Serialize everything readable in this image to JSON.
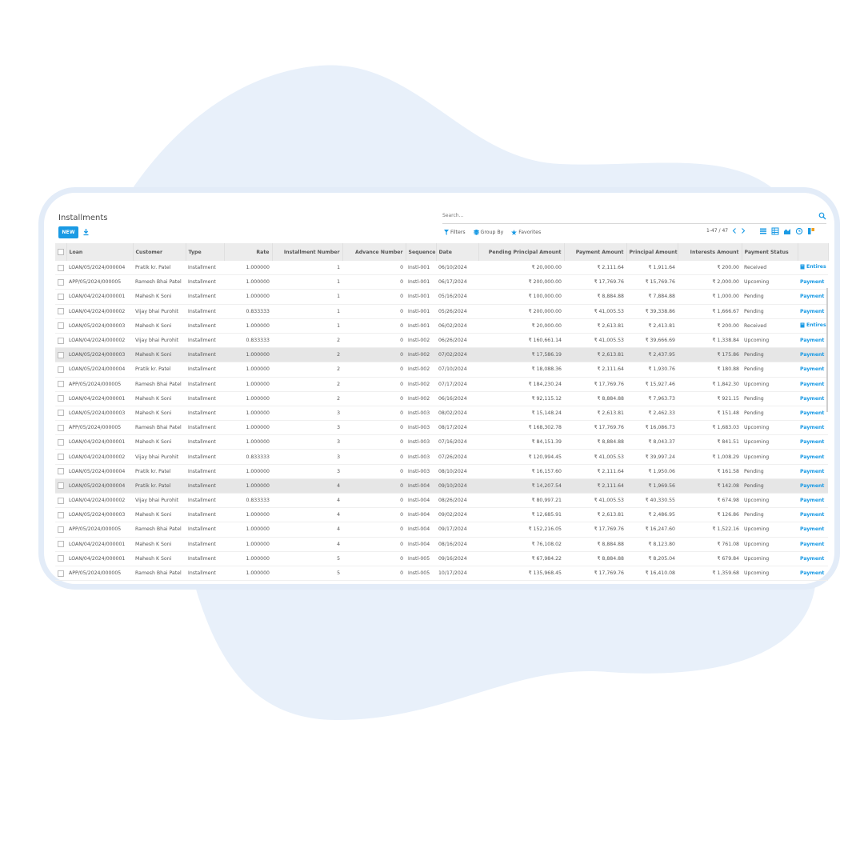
{
  "header": {
    "title": "Installments",
    "search_placeholder": "Search...",
    "new_label": "NEW",
    "filters_label": "Filters",
    "group_by_label": "Group By",
    "favorites_label": "Favorites",
    "pager": "1-47 / 47"
  },
  "colors": {
    "accent": "#1a9ae4",
    "header_bg": "#ececec",
    "blob": "#e8f0fa"
  },
  "table": {
    "columns": [
      "Loan",
      "Customer",
      "Type",
      "Rate",
      "Installment Number",
      "Advance Number",
      "Sequence",
      "Date",
      "Pending Principal Amount",
      "Payment Amount",
      "Principal Amount",
      "Interests Amount",
      "Payment Status"
    ],
    "rows": [
      {
        "loan": "LOAN/05/2024/000004",
        "customer": "Pratik kr. Patel",
        "type": "Installment",
        "rate": "1.000000",
        "inst": "1",
        "adv": "0",
        "seq": "Instl-001",
        "date": "06/10/2024",
        "pending": "₹ 20,000.00",
        "payment": "₹ 2,111.64",
        "principal": "₹ 1,911.64",
        "interest": "₹ 200.00",
        "status": "Received",
        "action": "Entires",
        "action_kind": "entries"
      },
      {
        "loan": "APP/05/2024/000005",
        "customer": "Ramesh Bhai Patel",
        "type": "Installment",
        "rate": "1.000000",
        "inst": "1",
        "adv": "0",
        "seq": "Instl-001",
        "date": "06/17/2024",
        "pending": "₹ 200,000.00",
        "payment": "₹ 17,769.76",
        "principal": "₹ 15,769.76",
        "interest": "₹ 2,000.00",
        "status": "Upcoming",
        "action": "Payment",
        "action_kind": "payment"
      },
      {
        "loan": "LOAN/04/2024/000001",
        "customer": "Mahesh K Soni",
        "type": "Installment",
        "rate": "1.000000",
        "inst": "1",
        "adv": "0",
        "seq": "Instl-001",
        "date": "05/16/2024",
        "pending": "₹ 100,000.00",
        "payment": "₹ 8,884.88",
        "principal": "₹ 7,884.88",
        "interest": "₹ 1,000.00",
        "status": "Pending",
        "action": "Payment",
        "action_kind": "payment"
      },
      {
        "loan": "LOAN/04/2024/000002",
        "customer": "Vijay bhai Purohit",
        "type": "Installment",
        "rate": "0.833333",
        "inst": "1",
        "adv": "0",
        "seq": "Instl-001",
        "date": "05/26/2024",
        "pending": "₹ 200,000.00",
        "payment": "₹ 41,005.53",
        "principal": "₹ 39,338.86",
        "interest": "₹ 1,666.67",
        "status": "Pending",
        "action": "Payment",
        "action_kind": "payment"
      },
      {
        "loan": "LOAN/05/2024/000003",
        "customer": "Mahesh K Soni",
        "type": "Installment",
        "rate": "1.000000",
        "inst": "1",
        "adv": "0",
        "seq": "Instl-001",
        "date": "06/02/2024",
        "pending": "₹ 20,000.00",
        "payment": "₹ 2,613.81",
        "principal": "₹ 2,413.81",
        "interest": "₹ 200.00",
        "status": "Received",
        "action": "Entires",
        "action_kind": "entries"
      },
      {
        "loan": "LOAN/04/2024/000002",
        "customer": "Vijay bhai Purohit",
        "type": "Installment",
        "rate": "0.833333",
        "inst": "2",
        "adv": "0",
        "seq": "Instl-002",
        "date": "06/26/2024",
        "pending": "₹ 160,661.14",
        "payment": "₹ 41,005.53",
        "principal": "₹ 39,666.69",
        "interest": "₹ 1,338.84",
        "status": "Upcoming",
        "action": "Payment",
        "action_kind": "payment"
      },
      {
        "loan": "LOAN/05/2024/000003",
        "customer": "Mahesh K Soni",
        "type": "Installment",
        "rate": "1.000000",
        "inst": "2",
        "adv": "0",
        "seq": "Instl-002",
        "date": "07/02/2024",
        "pending": "₹ 17,586.19",
        "payment": "₹ 2,613.81",
        "principal": "₹ 2,437.95",
        "interest": "₹ 175.86",
        "status": "Pending",
        "action": "Payment",
        "action_kind": "payment",
        "highlight": true
      },
      {
        "loan": "LOAN/05/2024/000004",
        "customer": "Pratik kr. Patel",
        "type": "Installment",
        "rate": "1.000000",
        "inst": "2",
        "adv": "0",
        "seq": "Instl-002",
        "date": "07/10/2024",
        "pending": "₹ 18,088.36",
        "payment": "₹ 2,111.64",
        "principal": "₹ 1,930.76",
        "interest": "₹ 180.88",
        "status": "Pending",
        "action": "Payment",
        "action_kind": "payment"
      },
      {
        "loan": "APP/05/2024/000005",
        "customer": "Ramesh Bhai Patel",
        "type": "Installment",
        "rate": "1.000000",
        "inst": "2",
        "adv": "0",
        "seq": "Instl-002",
        "date": "07/17/2024",
        "pending": "₹ 184,230.24",
        "payment": "₹ 17,769.76",
        "principal": "₹ 15,927.46",
        "interest": "₹ 1,842.30",
        "status": "Upcoming",
        "action": "Payment",
        "action_kind": "payment"
      },
      {
        "loan": "LOAN/04/2024/000001",
        "customer": "Mahesh K Soni",
        "type": "Installment",
        "rate": "1.000000",
        "inst": "2",
        "adv": "0",
        "seq": "Instl-002",
        "date": "06/16/2024",
        "pending": "₹ 92,115.12",
        "payment": "₹ 8,884.88",
        "principal": "₹ 7,963.73",
        "interest": "₹ 921.15",
        "status": "Pending",
        "action": "Payment",
        "action_kind": "payment"
      },
      {
        "loan": "LOAN/05/2024/000003",
        "customer": "Mahesh K Soni",
        "type": "Installment",
        "rate": "1.000000",
        "inst": "3",
        "adv": "0",
        "seq": "Instl-003",
        "date": "08/02/2024",
        "pending": "₹ 15,148.24",
        "payment": "₹ 2,613.81",
        "principal": "₹ 2,462.33",
        "interest": "₹ 151.48",
        "status": "Pending",
        "action": "Payment",
        "action_kind": "payment"
      },
      {
        "loan": "APP/05/2024/000005",
        "customer": "Ramesh Bhai Patel",
        "type": "Installment",
        "rate": "1.000000",
        "inst": "3",
        "adv": "0",
        "seq": "Instl-003",
        "date": "08/17/2024",
        "pending": "₹ 168,302.78",
        "payment": "₹ 17,769.76",
        "principal": "₹ 16,086.73",
        "interest": "₹ 1,683.03",
        "status": "Upcoming",
        "action": "Payment",
        "action_kind": "payment"
      },
      {
        "loan": "LOAN/04/2024/000001",
        "customer": "Mahesh K Soni",
        "type": "Installment",
        "rate": "1.000000",
        "inst": "3",
        "adv": "0",
        "seq": "Instl-003",
        "date": "07/16/2024",
        "pending": "₹ 84,151.39",
        "payment": "₹ 8,884.88",
        "principal": "₹ 8,043.37",
        "interest": "₹ 841.51",
        "status": "Upcoming",
        "action": "Payment",
        "action_kind": "payment"
      },
      {
        "loan": "LOAN/04/2024/000002",
        "customer": "Vijay bhai Purohit",
        "type": "Installment",
        "rate": "0.833333",
        "inst": "3",
        "adv": "0",
        "seq": "Instl-003",
        "date": "07/26/2024",
        "pending": "₹ 120,994.45",
        "payment": "₹ 41,005.53",
        "principal": "₹ 39,997.24",
        "interest": "₹ 1,008.29",
        "status": "Upcoming",
        "action": "Payment",
        "action_kind": "payment"
      },
      {
        "loan": "LOAN/05/2024/000004",
        "customer": "Pratik kr. Patel",
        "type": "Installment",
        "rate": "1.000000",
        "inst": "3",
        "adv": "0",
        "seq": "Instl-003",
        "date": "08/10/2024",
        "pending": "₹ 16,157.60",
        "payment": "₹ 2,111.64",
        "principal": "₹ 1,950.06",
        "interest": "₹ 161.58",
        "status": "Pending",
        "action": "Payment",
        "action_kind": "payment"
      },
      {
        "loan": "LOAN/05/2024/000004",
        "customer": "Pratik kr. Patel",
        "type": "Installment",
        "rate": "1.000000",
        "inst": "4",
        "adv": "0",
        "seq": "Instl-004",
        "date": "09/10/2024",
        "pending": "₹ 14,207.54",
        "payment": "₹ 2,111.64",
        "principal": "₹ 1,969.56",
        "interest": "₹ 142.08",
        "status": "Pending",
        "action": "Payment",
        "action_kind": "payment",
        "highlight": true
      },
      {
        "loan": "LOAN/04/2024/000002",
        "customer": "Vijay bhai Purohit",
        "type": "Installment",
        "rate": "0.833333",
        "inst": "4",
        "adv": "0",
        "seq": "Instl-004",
        "date": "08/26/2024",
        "pending": "₹ 80,997.21",
        "payment": "₹ 41,005.53",
        "principal": "₹ 40,330.55",
        "interest": "₹ 674.98",
        "status": "Upcoming",
        "action": "Payment",
        "action_kind": "payment"
      },
      {
        "loan": "LOAN/05/2024/000003",
        "customer": "Mahesh K Soni",
        "type": "Installment",
        "rate": "1.000000",
        "inst": "4",
        "adv": "0",
        "seq": "Instl-004",
        "date": "09/02/2024",
        "pending": "₹ 12,685.91",
        "payment": "₹ 2,613.81",
        "principal": "₹ 2,486.95",
        "interest": "₹ 126.86",
        "status": "Pending",
        "action": "Payment",
        "action_kind": "payment"
      },
      {
        "loan": "APP/05/2024/000005",
        "customer": "Ramesh Bhai Patel",
        "type": "Installment",
        "rate": "1.000000",
        "inst": "4",
        "adv": "0",
        "seq": "Instl-004",
        "date": "09/17/2024",
        "pending": "₹ 152,216.05",
        "payment": "₹ 17,769.76",
        "principal": "₹ 16,247.60",
        "interest": "₹ 1,522.16",
        "status": "Upcoming",
        "action": "Payment",
        "action_kind": "payment"
      },
      {
        "loan": "LOAN/04/2024/000001",
        "customer": "Mahesh K Soni",
        "type": "Installment",
        "rate": "1.000000",
        "inst": "4",
        "adv": "0",
        "seq": "Instl-004",
        "date": "08/16/2024",
        "pending": "₹ 76,108.02",
        "payment": "₹ 8,884.88",
        "principal": "₹ 8,123.80",
        "interest": "₹ 761.08",
        "status": "Upcoming",
        "action": "Payment",
        "action_kind": "payment"
      },
      {
        "loan": "LOAN/04/2024/000001",
        "customer": "Mahesh K Soni",
        "type": "Installment",
        "rate": "1.000000",
        "inst": "5",
        "adv": "0",
        "seq": "Instl-005",
        "date": "09/16/2024",
        "pending": "₹ 67,984.22",
        "payment": "₹ 8,884.88",
        "principal": "₹ 8,205.04",
        "interest": "₹ 679.84",
        "status": "Upcoming",
        "action": "Payment",
        "action_kind": "payment"
      },
      {
        "loan": "APP/05/2024/000005",
        "customer": "Ramesh Bhai Patel",
        "type": "Installment",
        "rate": "1.000000",
        "inst": "5",
        "adv": "0",
        "seq": "Instl-005",
        "date": "10/17/2024",
        "pending": "₹ 135,968.45",
        "payment": "₹ 17,769.76",
        "principal": "₹ 16,410.08",
        "interest": "₹ 1,359.68",
        "status": "Upcoming",
        "action": "Payment",
        "action_kind": "payment"
      }
    ]
  }
}
